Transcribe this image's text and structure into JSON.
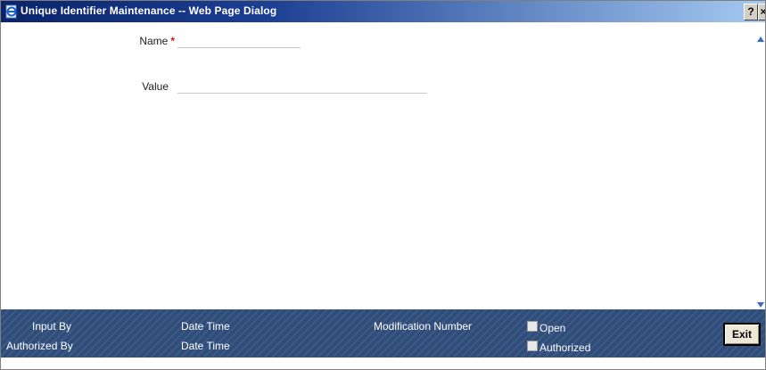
{
  "window": {
    "title": "Unique Identifier Maintenance -- Web Page Dialog",
    "help_label": "?",
    "close_label": "×"
  },
  "form": {
    "name_label": "Name",
    "required_marker": "*",
    "name_value": "",
    "value_label": "Value",
    "value_value": ""
  },
  "footer": {
    "input_by_label": "Input By",
    "authorized_by_label": "Authorized By",
    "date_time_label_1": "Date Time",
    "date_time_label_2": "Date Time",
    "modification_number_label": "Modification Number",
    "open_label": "Open",
    "authorized_label": "Authorized",
    "exit_label": "Exit"
  },
  "colors": {
    "titlebar_start": "#0a246a",
    "footer_bg": "#2f4d7a",
    "required": "#dd1111"
  },
  "icons": {
    "title_icon": "ie-page-icon",
    "scroll_up": "scroll-up-arrow-icon",
    "scroll_down": "scroll-down-arrow-icon"
  }
}
